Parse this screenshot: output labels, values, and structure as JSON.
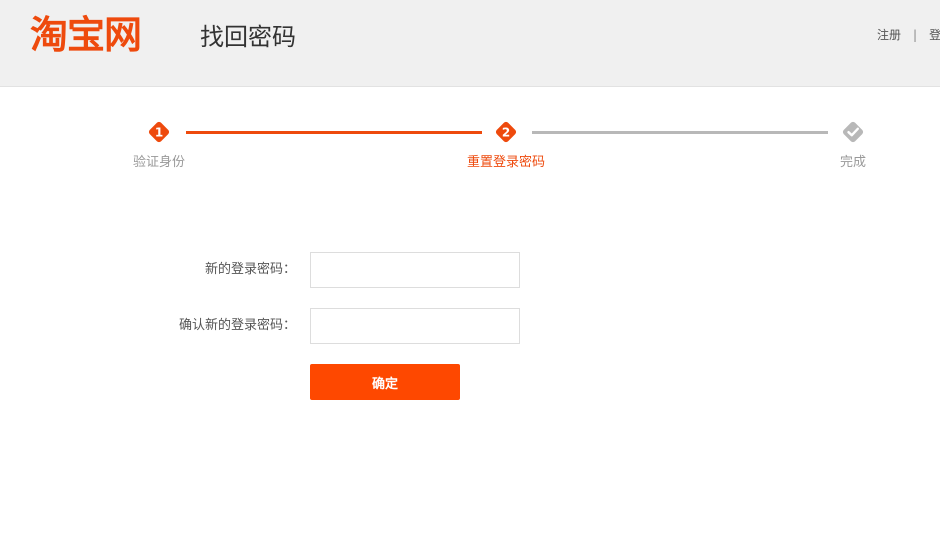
{
  "header": {
    "logo_text": "淘宝网",
    "page_title": "找回密码",
    "links": {
      "register": "注册",
      "separator": "|",
      "login": "登"
    }
  },
  "steps": [
    {
      "number": "1",
      "label": "验证身份",
      "state": "done"
    },
    {
      "number": "2",
      "label": "重置登录密码",
      "state": "current"
    },
    {
      "number": "",
      "label": "完成",
      "state": "todo"
    }
  ],
  "form": {
    "new_password_label": "新的登录密码：",
    "new_password_value": "",
    "confirm_password_label": "确认新的登录密码：",
    "confirm_password_value": "",
    "submit_label": "确定"
  },
  "colors": {
    "accent": "#ee4a0d",
    "button": "#fe4800",
    "inactive": "#b8b8b8"
  }
}
